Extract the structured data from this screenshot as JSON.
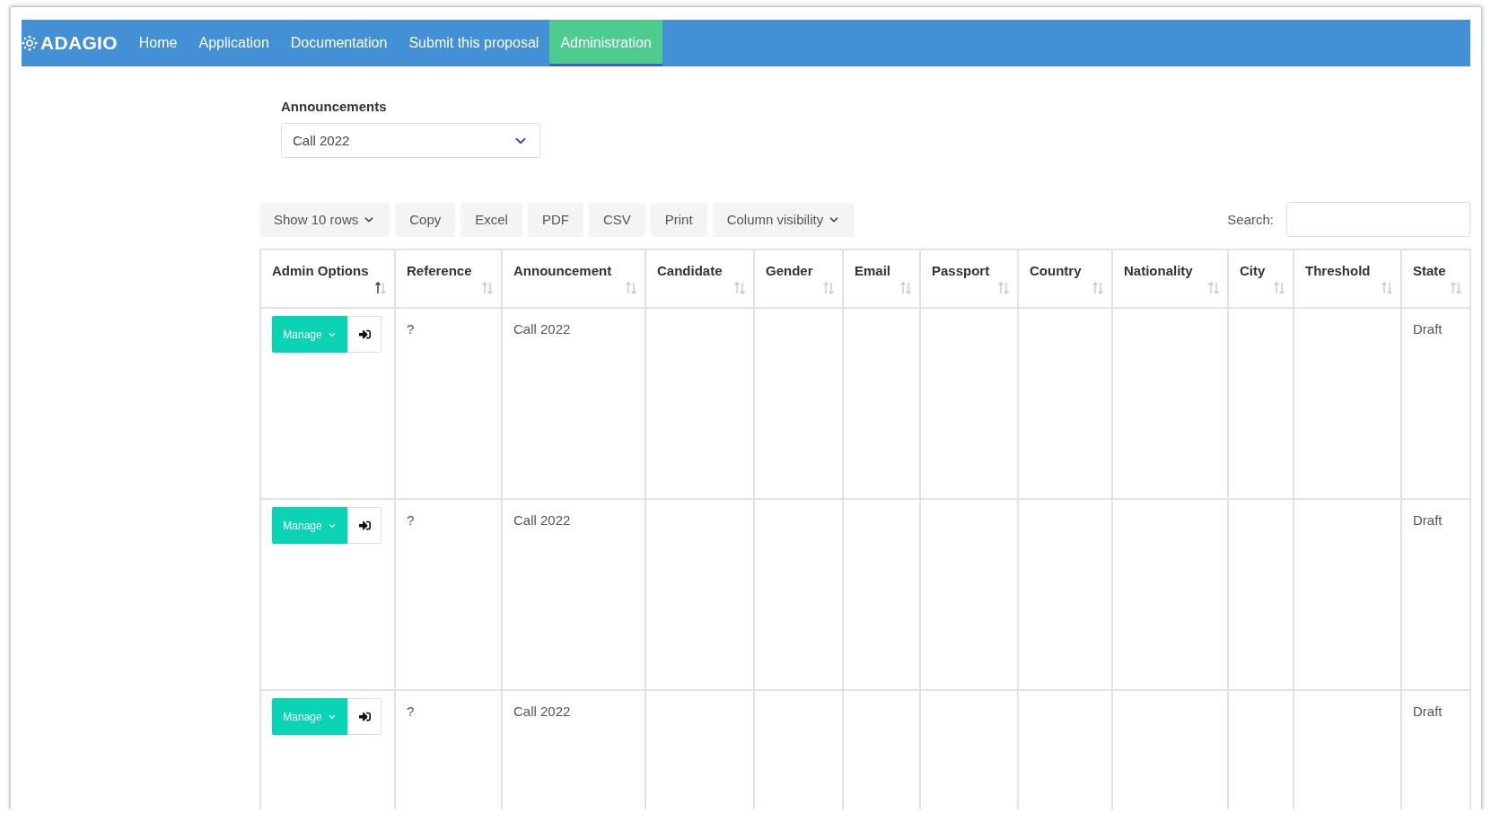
{
  "nav": {
    "logo": "ADAGIO",
    "items": [
      {
        "label": "Home",
        "selected": false
      },
      {
        "label": "Application",
        "selected": false
      },
      {
        "label": "Documentation",
        "selected": false
      },
      {
        "label": "Submit this proposal",
        "selected": false
      },
      {
        "label": "Administration",
        "selected": true
      }
    ]
  },
  "announcements": {
    "label": "Announcements",
    "value": "Call 2022"
  },
  "toolbar": {
    "buttons": [
      {
        "label": "Show 10 rows",
        "kind": "dropdown"
      },
      {
        "label": "Copy",
        "kind": "plain"
      },
      {
        "label": "Excel",
        "kind": "plain"
      },
      {
        "label": "PDF",
        "kind": "plain"
      },
      {
        "label": "CSV",
        "kind": "plain"
      },
      {
        "label": "Print",
        "kind": "plain"
      },
      {
        "label": "Column visibility",
        "kind": "dropdown"
      }
    ],
    "search_label": "Search:"
  },
  "table": {
    "columns": [
      {
        "label": "Admin Options",
        "sorted": true
      },
      {
        "label": "Reference",
        "sorted": false
      },
      {
        "label": "Announcement",
        "sorted": false
      },
      {
        "label": "Candidate",
        "sorted": false
      },
      {
        "label": "Gender",
        "sorted": false
      },
      {
        "label": "Email",
        "sorted": false
      },
      {
        "label": "Passport",
        "sorted": false
      },
      {
        "label": "Country",
        "sorted": false
      },
      {
        "label": "Nationality",
        "sorted": false
      },
      {
        "label": "City",
        "sorted": false
      },
      {
        "label": "Threshold",
        "sorted": false
      },
      {
        "label": "State",
        "sorted": false
      }
    ],
    "rows": [
      {
        "action": "Manage",
        "reference": "?",
        "announcement": "Call 2022",
        "state": "Draft"
      },
      {
        "action": "Manage",
        "reference": "?",
        "announcement": "Call 2022",
        "state": "Draft"
      },
      {
        "action": "Manage",
        "reference": "?",
        "announcement": "Call 2022",
        "state": "Draft"
      }
    ]
  }
}
